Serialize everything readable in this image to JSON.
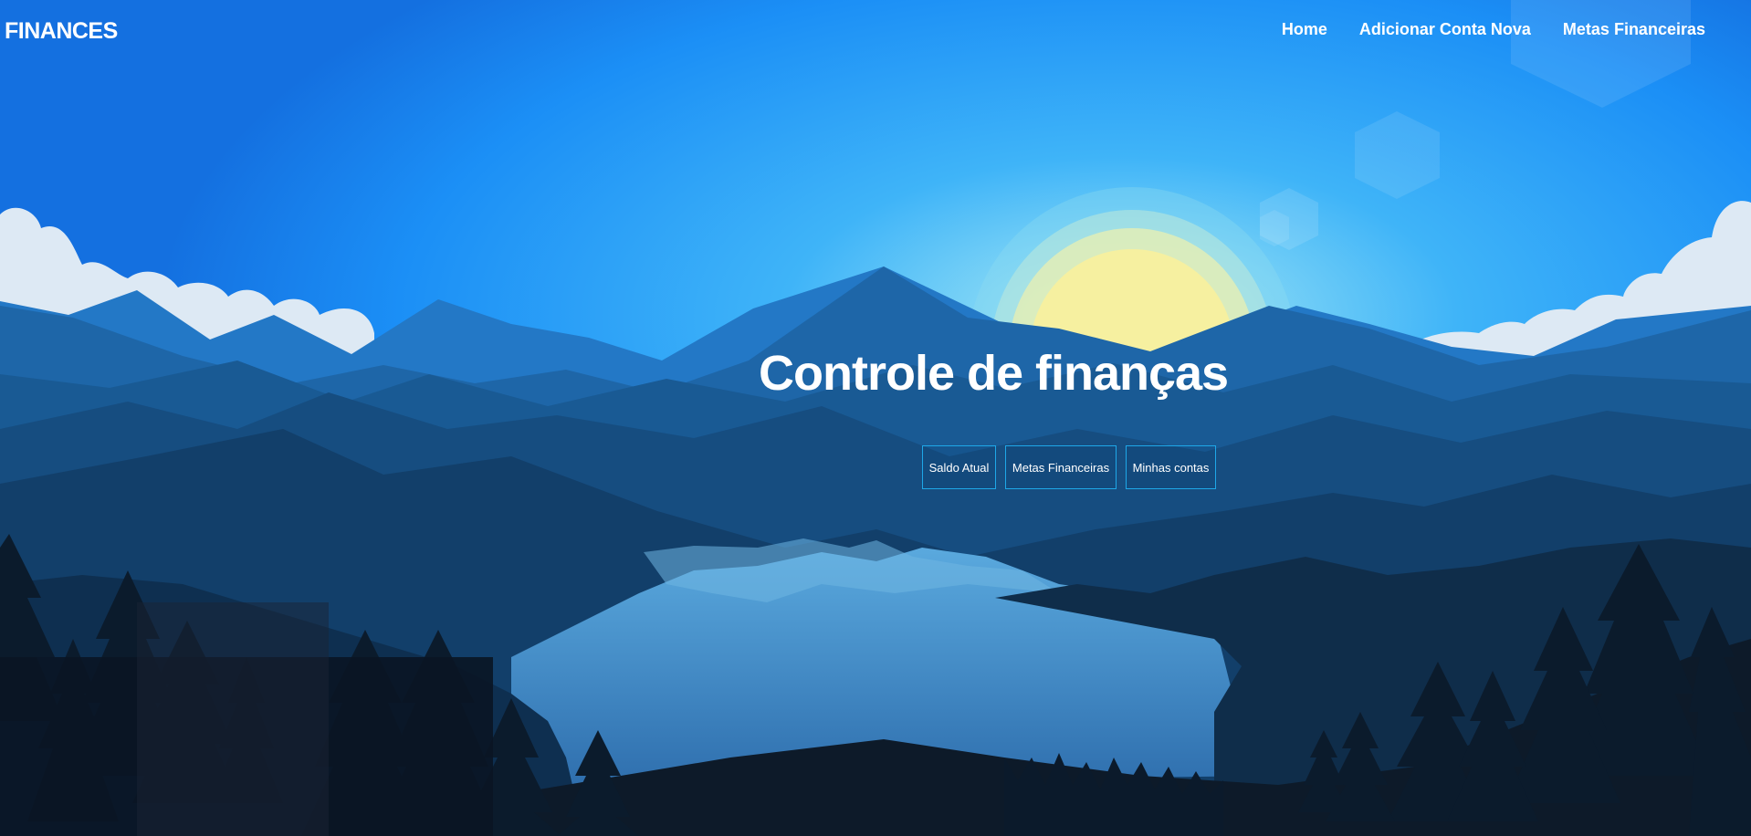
{
  "brand": "FINANCES",
  "nav": {
    "home": "Home",
    "add_account": "Adicionar Conta Nova",
    "goals": "Metas Financeiras"
  },
  "hero": {
    "title": "Controle de finanças",
    "buttons": {
      "balance": "Saldo Atual",
      "goals": "Metas Financeiras",
      "accounts": "Minhas contas"
    }
  },
  "colors": {
    "sky_top": "#1674e6",
    "sky_mid": "#1b8cf5",
    "sun": "#f4f0a0",
    "button_border": "#1ea7e8",
    "text": "#ffffff"
  }
}
